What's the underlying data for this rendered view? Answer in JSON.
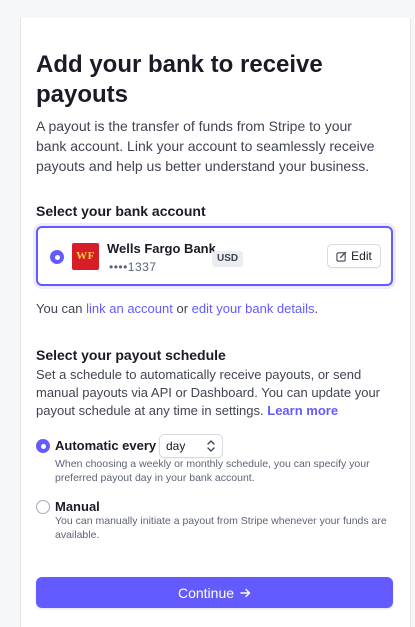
{
  "page": {
    "title": "Add your bank to receive payouts",
    "intro": "A payout is the transfer of funds from Stripe to your bank account. Link your account to seamlessly receive payouts and help us better understand your business."
  },
  "bank_section": {
    "heading": "Select your bank account",
    "account": {
      "logo_text": "WF",
      "name": "Wells Fargo Bank",
      "masked_number": "••••1337",
      "currency": "USD",
      "selected": true
    },
    "edit_label": "Edit",
    "help": {
      "prefix": "You can ",
      "link1": "link an account",
      "middle": " or ",
      "link2": "edit your bank details",
      "suffix": "."
    }
  },
  "schedule_section": {
    "heading": "Select your payout schedule",
    "description": "Set a schedule to automatically receive payouts, or send manual payouts via API or Dashboard. You can update your payout schedule at any time in settings.",
    "learn_more": "Learn more",
    "options": [
      {
        "label": "Automatic every",
        "selected": true,
        "interval_value": "day",
        "description": "When choosing a weekly or monthly schedule, you can specify your preferred payout day in your bank account."
      },
      {
        "label": "Manual",
        "selected": false,
        "description": "You can manually initiate a payout from Stripe whenever your funds are available."
      }
    ]
  },
  "continue_label": "Continue",
  "colors": {
    "accent": "#635bff",
    "bank_brand_red": "#d71e28",
    "bank_brand_gold": "#ffcd41"
  }
}
